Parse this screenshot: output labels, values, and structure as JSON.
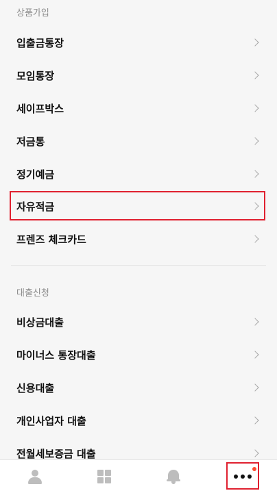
{
  "sections": {
    "products": {
      "header": "상품가입",
      "items": [
        {
          "label": "입출금통장"
        },
        {
          "label": "모임통장"
        },
        {
          "label": "세이프박스"
        },
        {
          "label": "저금통"
        },
        {
          "label": "정기예금"
        },
        {
          "label": "자유적금"
        },
        {
          "label": "프렌즈 체크카드"
        }
      ]
    },
    "loans": {
      "header": "대출신청",
      "items": [
        {
          "label": "비상금대출"
        },
        {
          "label": "마이너스 통장대출"
        },
        {
          "label": "신용대출"
        },
        {
          "label": "개인사업자 대출"
        },
        {
          "label": "전월세보증금 대출"
        }
      ]
    }
  },
  "tabbar": {
    "tabs": [
      {
        "icon": "person-icon"
      },
      {
        "icon": "grid-icon"
      },
      {
        "icon": "bell-icon"
      },
      {
        "icon": "more-icon",
        "has_notification": true
      }
    ],
    "notification_color": "#ff4a2e"
  },
  "highlight_color": "#e0202f"
}
